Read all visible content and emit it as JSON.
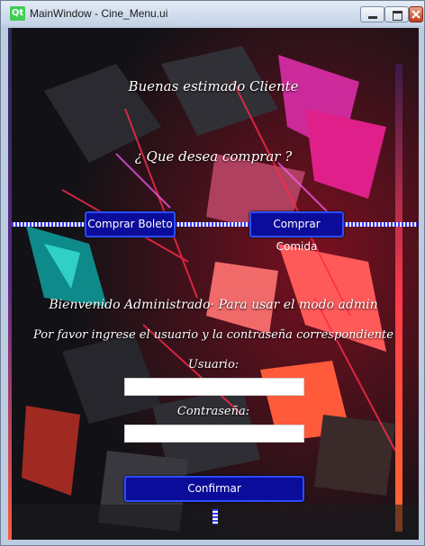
{
  "window": {
    "app_icon": "Qt",
    "title": "MainWindow - Cine_Menu.ui"
  },
  "main": {
    "greeting": "Buenas estimado Cliente",
    "question": "¿ Que desea comprar ?",
    "buttons": {
      "ticket": "Comprar Boleto",
      "food": "Comprar Comida",
      "confirm": "Confirmar"
    },
    "admin_welcome": "Bienvenido Administrado· Para usar el modo admin",
    "admin_instructions": "Por favor ingrese el usuario y la contraseña correspondiente",
    "user_label": "Usuario:",
    "user_value": "",
    "password_label": "Contraseña:",
    "password_value": ""
  },
  "colors": {
    "button_fill": "#0b0c9a",
    "button_border": "#2a4dff",
    "text": "#ffffff"
  },
  "icons": [
    "qt-logo-icon",
    "minimize-icon",
    "maximize-icon",
    "close-icon"
  ]
}
